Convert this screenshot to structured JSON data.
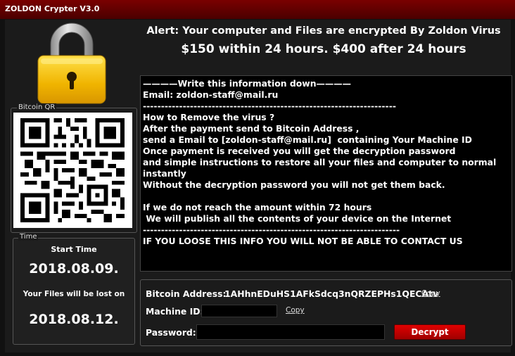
{
  "window": {
    "title": "ZOLDON Crypter V3.0"
  },
  "alert": {
    "line1": "Alert: Your computer and Files are encrypted By Zoldon Virus",
    "line2": "$150 within 24 hours. $400 after 24 hours"
  },
  "qr": {
    "label": "Bitcoin QR"
  },
  "time": {
    "label": "Time",
    "start_label": "Start Time",
    "start_date": "2018.08.09.",
    "lost_label": "Your Files will be lost on",
    "lost_date": "2018.08.12."
  },
  "message": {
    "lines": [
      "————Write this information down————",
      "Email: zoldon-staff@mail.ru",
      "----------------------------------------------------------------------",
      "How to Remove the virus ?",
      "After the payment send to Bitcoin Address ,",
      "send a Email to [zoldon-staff@mail.ru]  containing Your Machine ID",
      "Once payment is received you will get the decryption password",
      "and simple instructions to restore all your files and computer to normal",
      "instantly",
      "Without the decryption password you will not get them back.",
      "",
      "If we do not reach the amount within 72 hours",
      " We will publish all the contents of your device on the Internet",
      "-----------------------------------------------------------------------",
      "IF YOU LOOSE THIS INFO YOU WILL NOT BE ABLE TO CONTACT US"
    ]
  },
  "payment": {
    "bitcoin_label": "Bitcoin Address:",
    "bitcoin_address": "1AHhnEDuHS1AFkSdcq3nQRZEPHs1QECAtv",
    "copy_label": "Copy",
    "machine_label": "Machine ID:",
    "machine_value": "",
    "password_label": "Password:",
    "password_value": "",
    "decrypt_label": "Decrypt"
  },
  "colors": {
    "accent_red": "#c00000",
    "lock_yellow": "#f2c200"
  },
  "icons": {
    "lock": "padlock-icon"
  }
}
